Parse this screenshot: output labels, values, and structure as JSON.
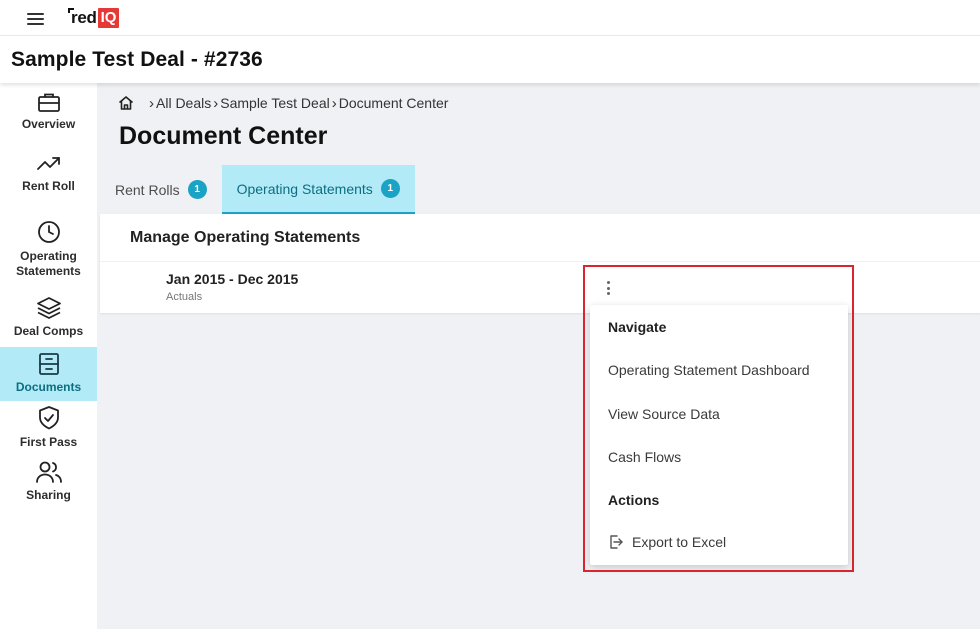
{
  "app": {
    "logo_text": "red",
    "logo_badge": "IQ",
    "deal_title": "Sample Test Deal - #2736"
  },
  "sidebar": {
    "items": [
      {
        "label": "Overview",
        "icon": "briefcase-icon"
      },
      {
        "label": "Rent Roll",
        "icon": "trend-up-icon"
      },
      {
        "label": "Operating Statements",
        "icon": "clock-icon"
      },
      {
        "label": "Deal Comps",
        "icon": "layers-icon"
      },
      {
        "label": "Documents",
        "icon": "file-cabinet-icon",
        "active": true
      },
      {
        "label": "First Pass",
        "icon": "shield-check-icon"
      },
      {
        "label": "Sharing",
        "icon": "users-icon"
      }
    ]
  },
  "breadcrumb": {
    "items": [
      "All Deals",
      "Sample Test Deal",
      "Document Center"
    ]
  },
  "page": {
    "title": "Document Center"
  },
  "tabs": [
    {
      "label": "Rent Rolls",
      "count": "1",
      "active": false
    },
    {
      "label": "Operating Statements",
      "count": "1",
      "active": true
    }
  ],
  "panel": {
    "heading": "Manage Operating Statements",
    "statement": {
      "title": "Jan 2015 - Dec 2015",
      "subtitle": "Actuals"
    }
  },
  "menu": {
    "navigate_heading": "Navigate",
    "navigate_items": [
      "Operating Statement Dashboard",
      "View Source Data",
      "Cash Flows"
    ],
    "actions_heading": "Actions",
    "action_items": [
      "Export to Excel"
    ]
  },
  "colors": {
    "accent": "#1aa3c4",
    "active_bg": "#b2ebf7",
    "logo_red": "#e53935",
    "highlight": "#d9262e"
  }
}
